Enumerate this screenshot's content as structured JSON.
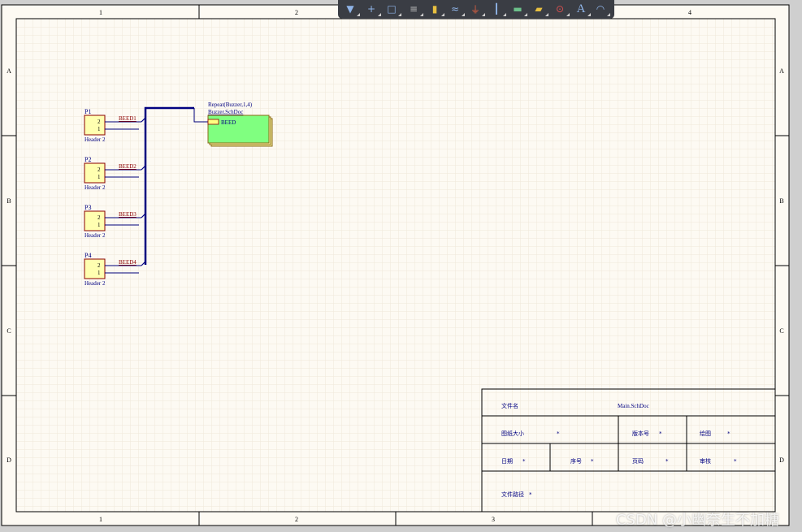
{
  "frame": {
    "col_labels": [
      "1",
      "2",
      "3",
      "4"
    ],
    "row_labels": [
      "A",
      "B",
      "C",
      "D"
    ]
  },
  "toolbar": {
    "icons": [
      "filter-icon",
      "crosshair-icon",
      "rectangle-select-icon",
      "align-icon",
      "part-icon",
      "wire-icon",
      "power-port-icon",
      "bus-icon",
      "sheet-symbol-icon",
      "net-label-icon",
      "port-icon",
      "text-icon",
      "arc-icon"
    ]
  },
  "connectors": [
    {
      "designator": "P1",
      "comment": "Header 2",
      "pins": [
        "2",
        "1"
      ],
      "net": "BEED1"
    },
    {
      "designator": "P2",
      "comment": "Header 2",
      "pins": [
        "2",
        "1"
      ],
      "net": "BEED2"
    },
    {
      "designator": "P3",
      "comment": "Header 2",
      "pins": [
        "2",
        "1"
      ],
      "net": "BEED3"
    },
    {
      "designator": "P4",
      "comment": "Header 2",
      "pins": [
        "2",
        "1"
      ],
      "net": "BEED4"
    }
  ],
  "sheet_symbol": {
    "designator": "Repeat(Buzzer,1,4)",
    "file_name": "Buzzer.SchDoc",
    "entry": "BEED"
  },
  "title_block": {
    "file_name_label": "文件名",
    "file_name_value": "Main.SchDoc",
    "size_label": "图纸大小",
    "size_value": "*",
    "revision_label": "版本号",
    "revision_value": "*",
    "drawn_label": "绘图",
    "drawn_value": "*",
    "date_label": "日期",
    "date_value": "*",
    "sheet_no_label": "序号",
    "sheet_no_value": "*",
    "page_label": "页码",
    "page_value": "*",
    "review_label": "审核",
    "review_value": "*",
    "path_label": "文件路径",
    "path_value": "*"
  },
  "watermark": "CSDN @小幽奈生不加糖",
  "colors": {
    "sheet_bg": "#fdfaf3",
    "grid": "#f0e8da",
    "border": "#000000",
    "wire": "#00007a",
    "bus": "#000080",
    "net_label": "#8b0000",
    "part_fill": "#ffffb0",
    "part_stroke": "#8b0000",
    "sheet_fill": "#80ff80",
    "text": "#000080"
  }
}
